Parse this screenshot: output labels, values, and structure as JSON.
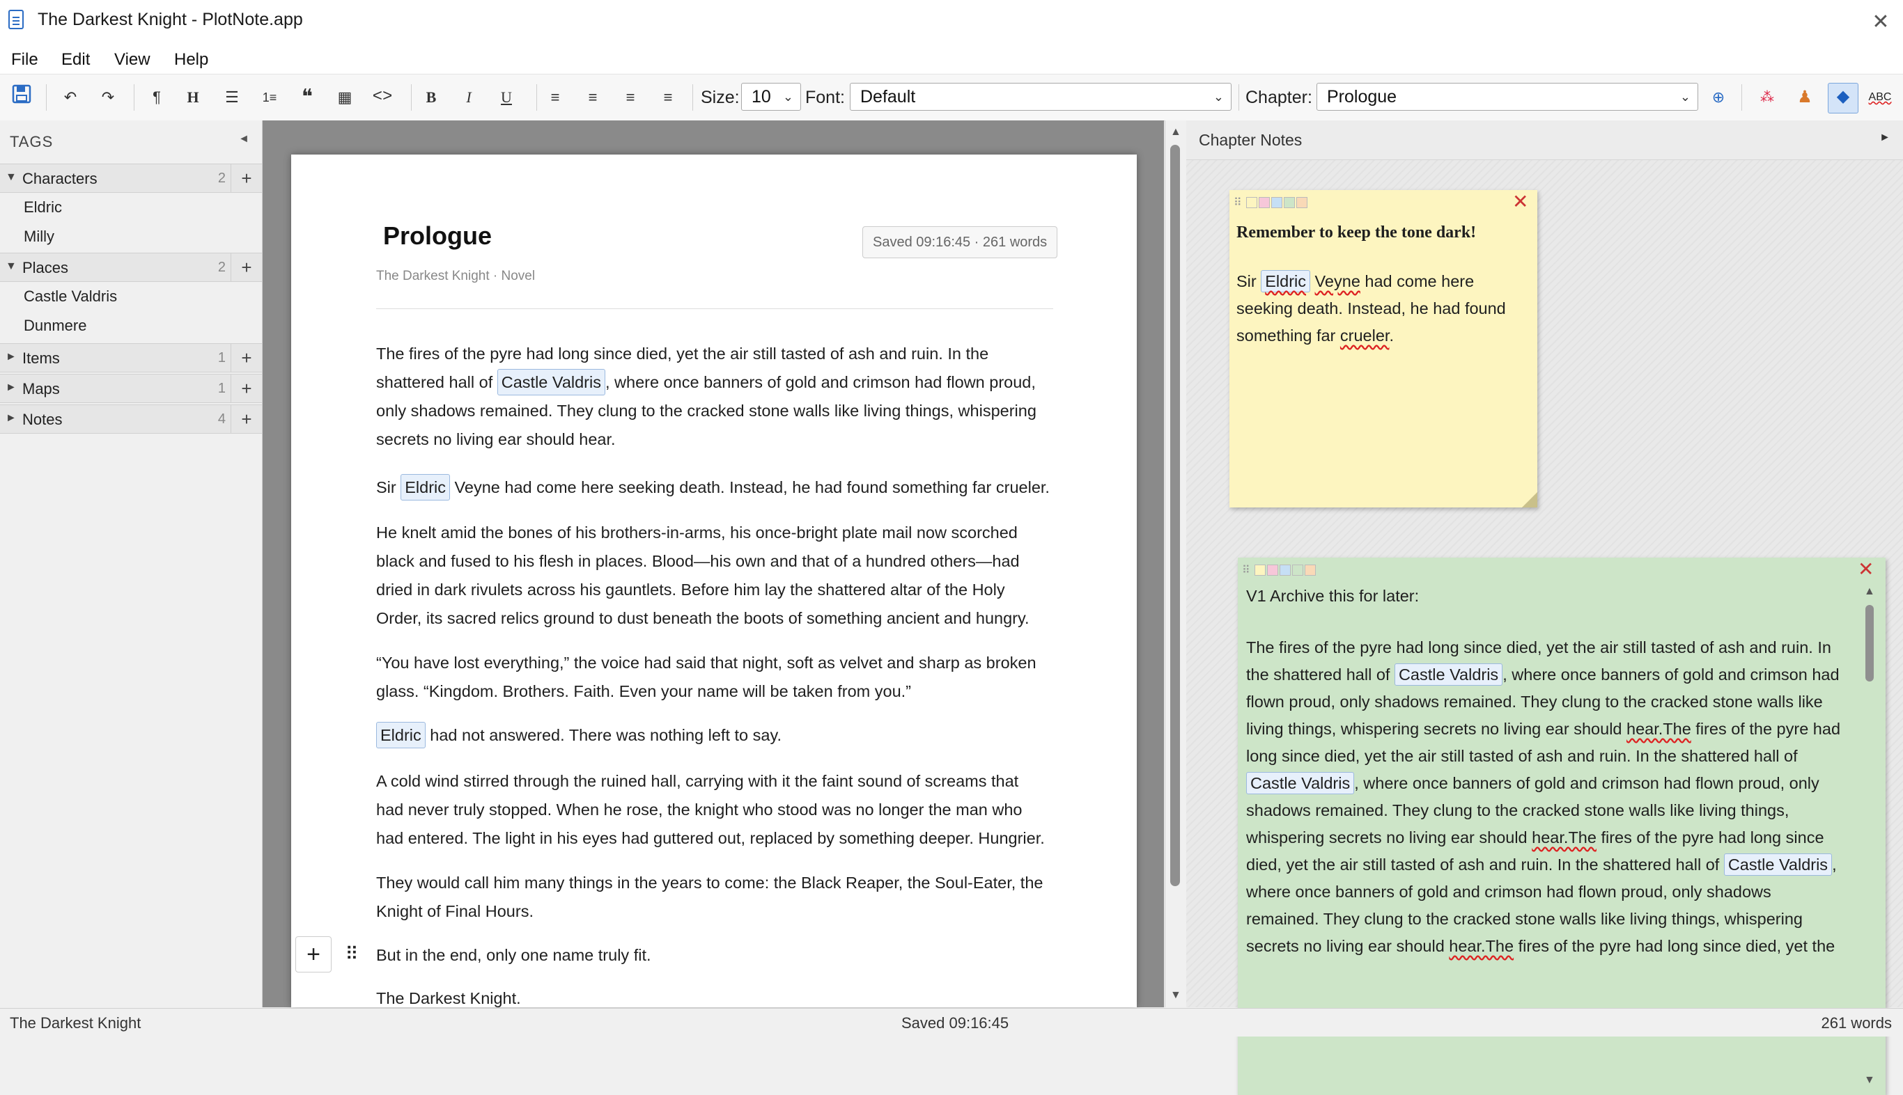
{
  "window": {
    "title": "The Darkest Knight - PlotNote.app",
    "close": "✕"
  },
  "menu": [
    "File",
    "Edit",
    "View",
    "Help"
  ],
  "toolbar": {
    "size_label": "Size:",
    "size_value": "10",
    "font_label": "Font:",
    "font_value": "Default",
    "chapter_label": "Chapter:",
    "chapter_value": "Prologue",
    "spellcheck": "ABC"
  },
  "sidebar": {
    "header": "TAGS",
    "groups": [
      {
        "label": "Characters",
        "count": "2",
        "expanded": true,
        "items": [
          "Eldric",
          "Milly"
        ]
      },
      {
        "label": "Places",
        "count": "2",
        "expanded": true,
        "items": [
          "Castle Valdris",
          "Dunmere"
        ]
      },
      {
        "label": "Items",
        "count": "1",
        "expanded": false,
        "items": []
      },
      {
        "label": "Maps",
        "count": "1",
        "expanded": false,
        "items": []
      },
      {
        "label": "Notes",
        "count": "4",
        "expanded": false,
        "items": []
      }
    ]
  },
  "document": {
    "title": "Prologue",
    "subtitle": "The Darkest Knight · Novel",
    "saved_badge": "Saved 09:16:45 · 261 words",
    "p1_a": "The fires of the pyre had long since died, yet the air still tasted of ash and ruin. In the",
    "p1_b1": "shattered hall of ",
    "p1_tag": "Castle Valdris",
    "p1_b2": ", where once banners of gold and crimson had flown proud,",
    "p1_c": "only shadows remained. They clung to the cracked stone walls like living things, whispering",
    "p1_d": "secrets no living ear should hear.",
    "p2_a": "Sir ",
    "p2_tag": "Eldric",
    "p2_b": " Veyne had come here seeking death. Instead, he had found something far crueler.",
    "p3_a": "He knelt amid the bones of his brothers-in-arms, his once-bright plate mail now scorched",
    "p3_b": "black and fused to his flesh in places. Blood—his own and that of a hundred others—had",
    "p3_c": "dried in dark rivulets across his gauntlets. Before him lay the shattered altar of the Holy",
    "p3_d": "Order, its sacred relics ground to dust beneath the boots of something ancient and hungry.",
    "p4_a": "“You have lost everything,” the voice had said that night, soft as velvet and sharp as broken",
    "p4_b": "glass. “Kingdom. Brothers. Faith. Even your name will be taken from you.”",
    "p5_tag": "Eldric",
    "p5_b": " had not answered. There was nothing left to say.",
    "p6_a": "A cold wind stirred through the ruined hall, carrying with it the faint sound of screams that",
    "p6_b": "had never truly stopped. When he rose, the knight who stood was no longer the man who",
    "p6_c": "had entered. The light in his eyes had guttered out, replaced by something deeper. Hungrier.",
    "p7_a": "They would call him many things in the years to come: the Black Reaper, the Soul-Eater, the",
    "p7_b": "Knight of Final Hours.",
    "p8": "But in the end, only one name truly fit.",
    "p9": "The Darkest Knight.",
    "add_block": "+",
    "drag_handle": "⠿"
  },
  "notes_panel": {
    "header": "Chapter Notes",
    "note1": {
      "color": "#fdf5c0",
      "title": "Remember to keep the tone dark!",
      "l1_a": "Sir ",
      "l1_tag": "Eldric",
      "l1_b": " ",
      "l1_c": "Veyne",
      "l1_d": " had come here",
      "l2": "seeking death. Instead, he had found",
      "l3_a": "something far ",
      "l3_b": "crueler",
      "l3_c": "."
    },
    "note2": {
      "color": "#cde5c8",
      "title": "V1 Archive this for later:",
      "l1": "The fires of the pyre had long since died, yet the air still tasted of ash and ruin. In",
      "l2_a": "the shattered hall of ",
      "l2_tag": "Castle Valdris",
      "l2_b": ", where once banners of gold and crimson had",
      "l3": "flown proud, only shadows remained. They clung to the cracked stone walls like",
      "l4_a": "living things, whispering secrets no living ear should ",
      "l4_b": "hear.The",
      "l4_c": " fires of the pyre had",
      "l5": "long since died, yet the air still tasted of ash and ruin. In the shattered hall of",
      "l6_tag": "Castle Valdris",
      "l6_b": ", where once banners of gold and crimson had flown proud, only",
      "l7": "shadows remained. They clung to the cracked stone walls like living things,",
      "l8_a": "whispering secrets no living ear should ",
      "l8_b": "hear.The",
      "l8_c": " fires of the pyre had long since",
      "l9_a": "died, yet the air still tasted of ash and ruin. In the shattered hall of ",
      "l9_tag": "Castle Valdris",
      "l9_b": ",",
      "l10": "where once banners of gold and crimson had flown proud, only shadows",
      "l11": "remained. They clung to the cracked stone walls like living things, whispering",
      "l12_a": "secrets no living ear should ",
      "l12_b": "hear.The",
      "l12_c": " fires of the pyre had long since died, yet the"
    }
  },
  "statusbar": {
    "left": "The Darkest Knight",
    "center": "Saved 09:16:45",
    "right": "261 words"
  }
}
